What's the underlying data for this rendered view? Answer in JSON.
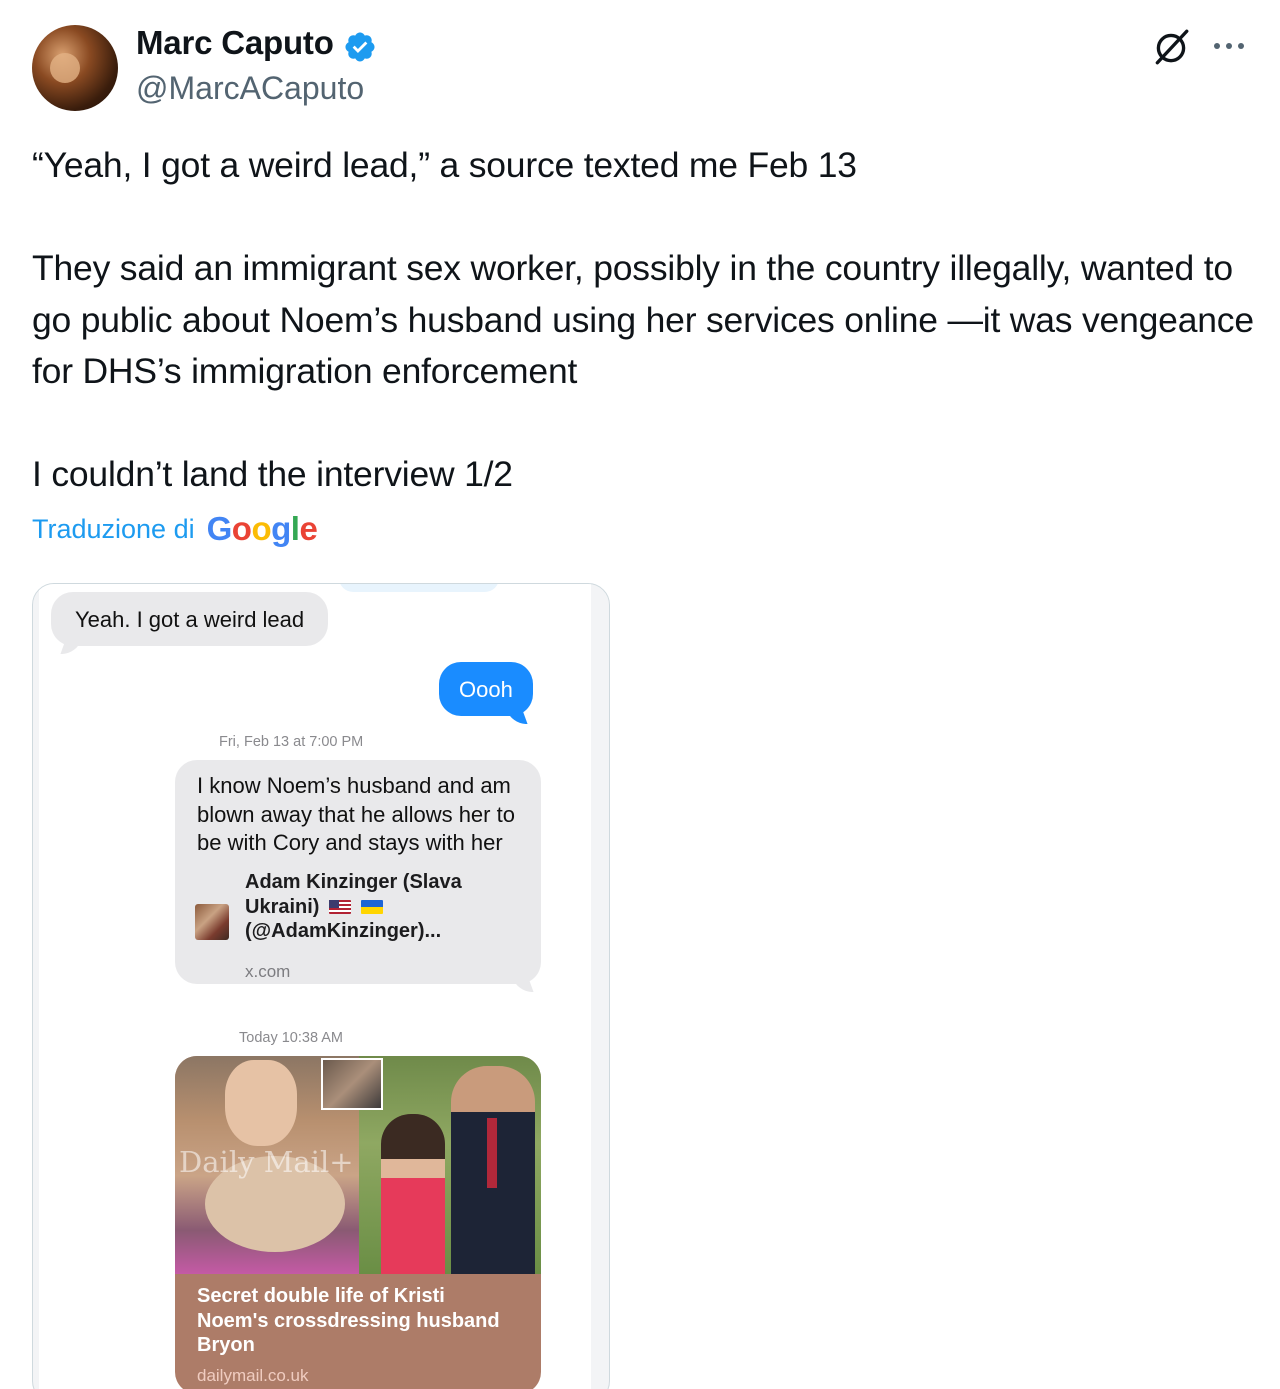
{
  "author": {
    "name": "Marc Caputo",
    "handle": "@MarcACaputo"
  },
  "tweet": {
    "text": "“Yeah, I got a weird lead,” a source texted me Feb 13\n\nThey said an immigrant sex worker, possibly in the country illegally, wanted to go public about Noem’s husband using her services online —it was vengeance for DHS’s immigration enforcement\n\nI couldn’t land the interview 1/2"
  },
  "translation": {
    "label": "Traduzione di",
    "provider_letters": [
      "G",
      "o",
      "o",
      "g",
      "l",
      "e"
    ]
  },
  "media": {
    "messages": [
      {
        "direction": "incoming",
        "text": "Yeah. I got a weird lead"
      },
      {
        "direction": "outgoing",
        "text": "Oooh"
      }
    ],
    "timestamp_1": "Fri, Feb 13 at 7:00 PM",
    "message_3": {
      "text": "I know Noem’s husband and am\nblown away that he allows her to\nbe with Cory and stays with her",
      "link_title_1": "Adam Kinzinger (Slava",
      "link_title_2": "Ukraini)",
      "link_title_3": "(@AdamKinzinger)...",
      "link_domain": "x.com"
    },
    "timestamp_2": "Today 10:38 AM",
    "message_4": {
      "watermark": "Daily Mail+",
      "caption": "Secret double life of Kristi\nNoem's crossdressing husband\nBryon",
      "domain": "dailymail.co.uk"
    }
  },
  "colors": {
    "accent": "#1d9bf0",
    "text": "#0f1419",
    "secondary": "#536471",
    "imessage_blue": "#1a8cff",
    "imessage_gray": "#e9e9eb"
  },
  "icons": [
    "verified-badge-icon",
    "grok-icon",
    "more-options-icon",
    "us-flag-icon",
    "ukraine-flag-icon"
  ]
}
